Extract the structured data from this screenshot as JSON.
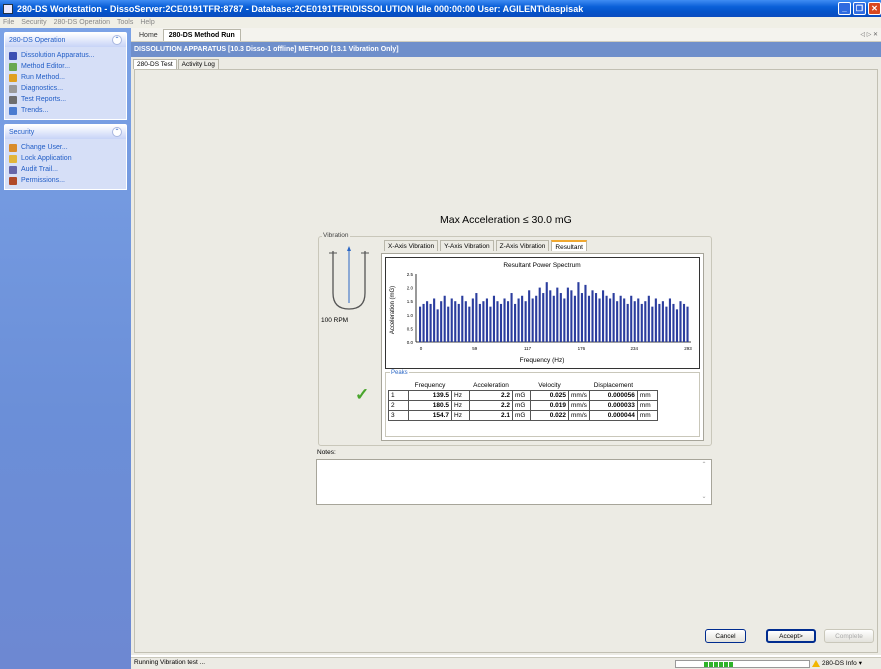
{
  "window": {
    "title": "280-DS Workstation - DissoServer:2CE0191TFR:8787 - Database:2CE0191TFR\\DISSOLUTION   Idle 000:00:00  User: AGILENT\\daspisak"
  },
  "menu": [
    "File",
    "Security",
    "280-DS Operation",
    "Tools",
    "Help"
  ],
  "sidebar": {
    "operation_panel": {
      "title": "280-DS Operation",
      "items": [
        {
          "label": "Dissolution Apparatus...",
          "icon": "apparatus-icon",
          "color": "#3a4fb3"
        },
        {
          "label": "Method Editor...",
          "icon": "method-editor-icon",
          "color": "#6aa84f"
        },
        {
          "label": "Run Method...",
          "icon": "run-method-icon",
          "color": "#e0a020"
        },
        {
          "label": "Diagnostics...",
          "icon": "diagnostics-icon",
          "color": "#999999"
        },
        {
          "label": "Test Reports...",
          "icon": "test-reports-icon",
          "color": "#6d6d6d"
        },
        {
          "label": "Trends...",
          "icon": "trends-icon",
          "color": "#4a7bd0"
        }
      ]
    },
    "security_panel": {
      "title": "Security",
      "items": [
        {
          "label": "Change User...",
          "icon": "change-user-icon",
          "color": "#d98c2a"
        },
        {
          "label": "Lock Application",
          "icon": "lock-icon",
          "color": "#e2b53a"
        },
        {
          "label": "Audit Trail...",
          "icon": "audit-trail-icon",
          "color": "#6666aa"
        },
        {
          "label": "Permissions...",
          "icon": "permissions-icon",
          "color": "#b04a2a"
        }
      ]
    }
  },
  "doc_tabs": [
    "Home",
    "280-DS Method Run"
  ],
  "banner": "DISSOLUTION APPARATUS [10.3 Disso-1 offline] METHOD [13.1 Vibration Only]",
  "sub_tabs": [
    "280-DS Test",
    "Activity Log"
  ],
  "max_acceleration": "Max Acceleration ≤ 30.0 mG",
  "vibration": {
    "legend": "Vibration",
    "rpm": "100 RPM",
    "chart_tabs": [
      "X-Axis Vibration",
      "Y-Axis Vibration",
      "Z-Axis Vibration",
      "Resultant"
    ],
    "active_chart_tab": "Resultant"
  },
  "chart_data": {
    "type": "bar",
    "title": "Resultant Power Spectrum",
    "xlabel": "Frequency (Hz)",
    "ylabel": "Acceleration (mG)",
    "xlim": [
      0,
      293
    ],
    "ylim": [
      0,
      2.5
    ],
    "x_ticks": [
      "0",
      "59",
      "117",
      "176",
      "234",
      "293"
    ],
    "y_ticks": [
      "0.0",
      "0.5",
      "1.0",
      "1.5",
      "2.0",
      "2.5"
    ],
    "series_color": "#2b3d9e",
    "values": [
      1.3,
      1.4,
      1.5,
      1.4,
      1.6,
      1.2,
      1.5,
      1.7,
      1.3,
      1.6,
      1.5,
      1.4,
      1.7,
      1.5,
      1.3,
      1.6,
      1.8,
      1.4,
      1.5,
      1.6,
      1.3,
      1.7,
      1.5,
      1.4,
      1.6,
      1.5,
      1.8,
      1.4,
      1.6,
      1.7,
      1.5,
      1.9,
      1.6,
      1.7,
      2.0,
      1.8,
      2.2,
      1.9,
      1.7,
      2.0,
      1.8,
      1.6,
      2.0,
      1.9,
      1.7,
      2.2,
      1.8,
      2.1,
      1.7,
      1.9,
      1.8,
      1.6,
      1.9,
      1.7,
      1.6,
      1.8,
      1.5,
      1.7,
      1.6,
      1.4,
      1.7,
      1.5,
      1.6,
      1.4,
      1.5,
      1.7,
      1.3,
      1.6,
      1.4,
      1.5,
      1.3,
      1.6,
      1.4,
      1.2,
      1.5,
      1.4,
      1.3
    ]
  },
  "peaks": {
    "legend": "Peaks",
    "headers": [
      "",
      "Frequency",
      "",
      "Acceleration",
      "",
      "Velocity",
      "",
      "Displacement",
      ""
    ],
    "rows": [
      {
        "n": "1",
        "freq": "139.5",
        "fu": "Hz",
        "acc": "2.2",
        "au": "mG",
        "vel": "0.025",
        "vu": "mm/s",
        "disp": "0.000056",
        "du": "mm"
      },
      {
        "n": "2",
        "freq": "180.5",
        "fu": "Hz",
        "acc": "2.2",
        "au": "mG",
        "vel": "0.019",
        "vu": "mm/s",
        "disp": "0.000033",
        "du": "mm"
      },
      {
        "n": "3",
        "freq": "154.7",
        "fu": "Hz",
        "acc": "2.1",
        "au": "mG",
        "vel": "0.022",
        "vu": "mm/s",
        "disp": "0.000044",
        "du": "mm"
      }
    ]
  },
  "notes": {
    "label": "Notes:",
    "value": ""
  },
  "buttons": {
    "cancel": "Cancel",
    "accept": "Accept>",
    "complete": "Complete"
  },
  "status": {
    "text": "Running Vibration test ...",
    "progress": 0.3,
    "info": "280-DS Info"
  }
}
